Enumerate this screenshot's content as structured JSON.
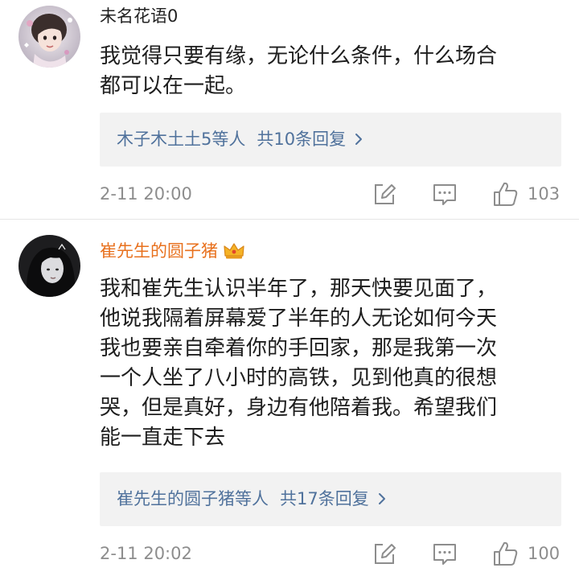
{
  "comments": [
    {
      "username": "未名花语0",
      "text_lines": [
        "我觉得只要有缘，无论什么条件，什么场合",
        "都可以在一起。"
      ],
      "replies_from": "木子木土土5等人",
      "replies_count": "共10条回复",
      "timestamp": "2-11 20:00",
      "likes": "103"
    },
    {
      "username": "崔先生的圆子猪",
      "text_lines": [
        "我和崔先生认识半年了，那天快要见面了，",
        "他说我隔着屏幕爱了半年的人无论如何今天",
        "我也要亲自牵着你的手回家，那是我第一次",
        "一个人坐了八小时的高铁，见到他真的很想",
        "哭，但是真好，身边有他陪着我。希望我们",
        "能一直走下去"
      ],
      "replies_from": "崔先生的圆子猪等人",
      "replies_count": "共17条回复",
      "timestamp": "2-11 20:02",
      "likes": "100"
    }
  ],
  "colors": {
    "username_default": "#222222",
    "username_vip": "#e8711e",
    "reply_link": "#50729c",
    "meta_gray": "#8d8d8d",
    "reply_box_bg": "#f2f2f2",
    "crown": "#f5b326"
  },
  "icons": {
    "repost": "edit-square-icon",
    "comment": "comment-bubble-icon",
    "like": "thumbs-up-icon",
    "vip": "crown-badge-icon",
    "more": "chevron-right-icon"
  }
}
